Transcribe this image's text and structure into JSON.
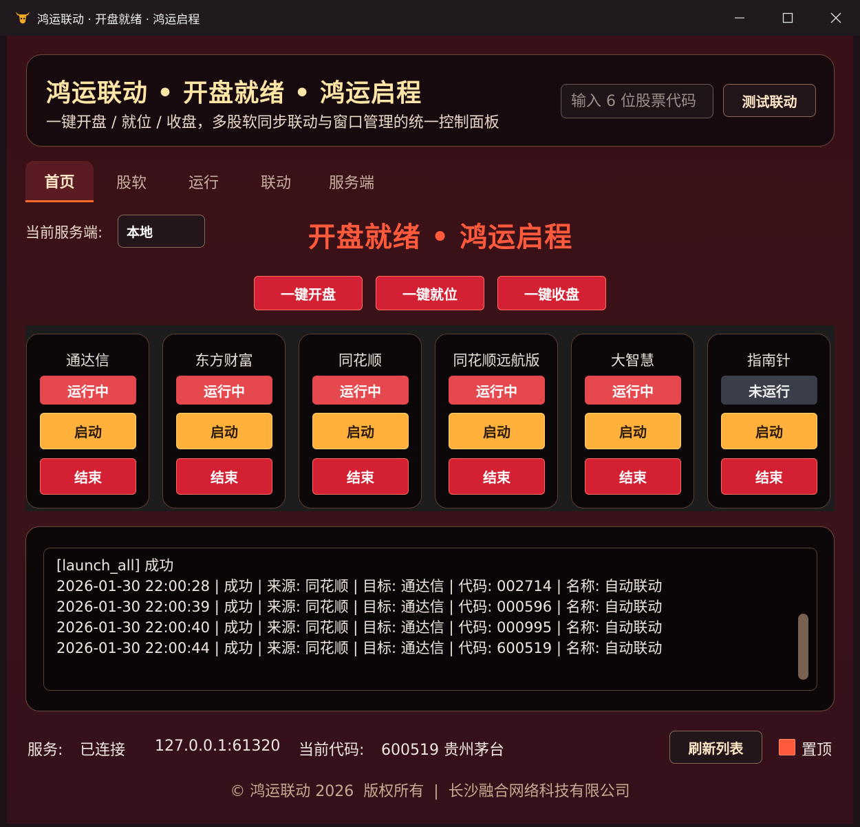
{
  "window": {
    "title": "鸿运联动 · 开盘就绪 · 鸿运启程",
    "icon": "bull-logo-icon"
  },
  "header": {
    "title": "鸿运联动 • 开盘就绪 • 鸿运启程",
    "subtitle": "一键开盘 / 就位 / 收盘，多股软同步联动与窗口管理的统一控制面板",
    "code_input_placeholder": "输入 6 位股票代码",
    "test_button": "测试联动"
  },
  "tabs": [
    {
      "label": "首页",
      "active": true
    },
    {
      "label": "股软",
      "active": false
    },
    {
      "label": "运行",
      "active": false
    },
    {
      "label": "联动",
      "active": false
    },
    {
      "label": "服务端",
      "active": false
    }
  ],
  "server": {
    "label": "当前服务端:",
    "value": "本地"
  },
  "hero_title": "开盘就绪 • 鸿运启程",
  "actions": {
    "open": "一键开盘",
    "ready": "一键就位",
    "close": "一键收盘"
  },
  "software": [
    {
      "name": "通达信",
      "status": "运行中",
      "start": "启动",
      "stop": "结束"
    },
    {
      "name": "东方财富",
      "status": "运行中",
      "start": "启动",
      "stop": "结束"
    },
    {
      "name": "同花顺",
      "status": "运行中",
      "start": "启动",
      "stop": "结束"
    },
    {
      "name": "同花顺远航版",
      "status": "运行中",
      "start": "启动",
      "stop": "结束"
    },
    {
      "name": "大智慧",
      "status": "运行中",
      "start": "启动",
      "stop": "结束"
    },
    {
      "name": "指南针",
      "status": "未运行",
      "start": "启动",
      "stop": "结束"
    }
  ],
  "log": [
    "[launch_all] 成功",
    "2026-01-30 22:00:28 | 成功 | 来源: 同花顺 | 目标: 通达信 | 代码: 002714 | 名称: 自动联动",
    "2026-01-30 22:00:39 | 成功 | 来源: 同花顺 | 目标: 通达信 | 代码: 000596 | 名称: 自动联动",
    "2026-01-30 22:00:40 | 成功 | 来源: 同花顺 | 目标: 通达信 | 代码: 000995 | 名称: 自动联动",
    "2026-01-30 22:00:44 | 成功 | 来源: 同花顺 | 目标: 通达信 | 代码: 600519 | 名称: 自动联动"
  ],
  "status": {
    "service_label": "服务:",
    "service_value": "已连接",
    "address": "127.0.0.1:61320",
    "code_label": "当前代码:",
    "code_value": "600519 贵州茅台",
    "refresh_button": "刷新列表",
    "pin_label": "置顶"
  },
  "footer": "© 鸿运联动 2026  版权所有  |  长沙融合网络科技有限公司",
  "colors": {
    "accent_red": "#d42033",
    "running_red": "#e5484d",
    "start_orange": "#ffb13c",
    "hero_red": "#ff5a3c",
    "title_gold": "#ffe6a6"
  }
}
